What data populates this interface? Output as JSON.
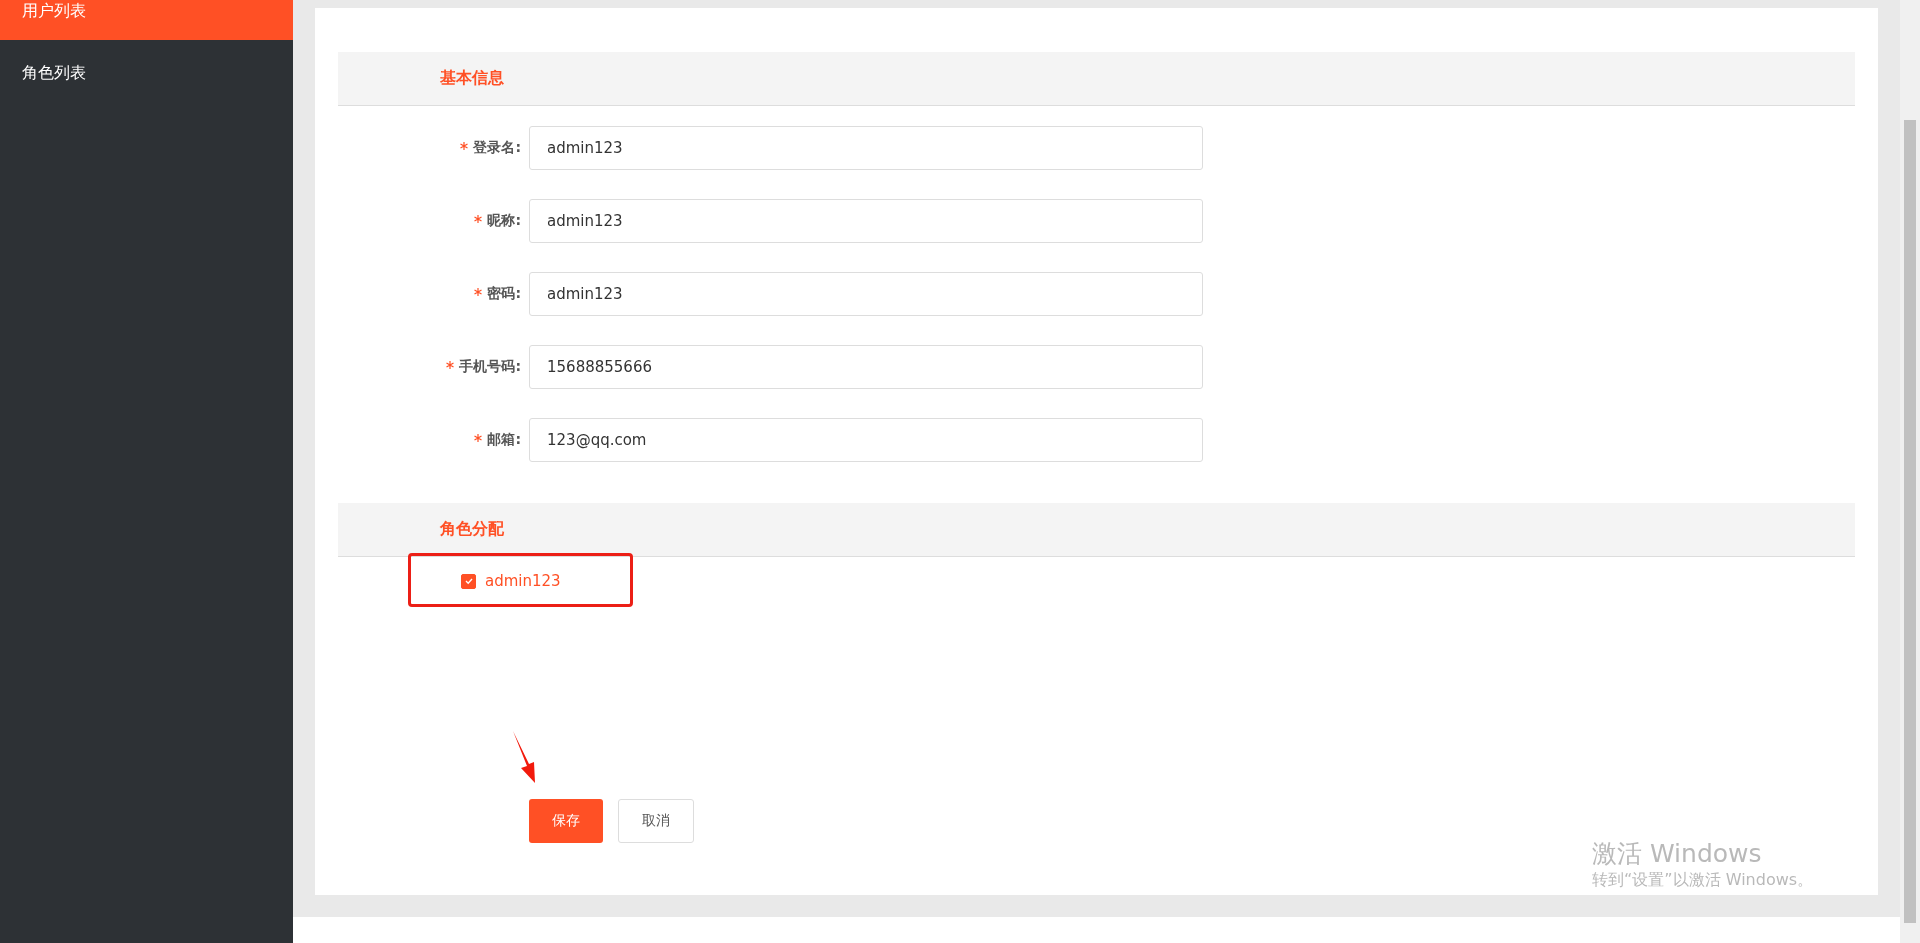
{
  "sidebar": {
    "items": [
      {
        "label": "用户列表",
        "selected": true
      },
      {
        "label": "角色列表",
        "selected": false
      }
    ]
  },
  "sections": [
    {
      "title": "基本信息",
      "kind": "fields",
      "fields": [
        {
          "label": "登录名:",
          "required": true,
          "value": "admin123"
        },
        {
          "label": "昵称:",
          "required": true,
          "value": "admin123"
        },
        {
          "label": "密码:",
          "required": true,
          "value": "admin123"
        },
        {
          "label": "手机号码:",
          "required": true,
          "value": "15688855666"
        },
        {
          "label": "邮箱:",
          "required": true,
          "value": "123@qq.com"
        }
      ]
    },
    {
      "title": "角色分配",
      "kind": "checkboxes",
      "options": [
        {
          "label": "admin123",
          "checked": true
        }
      ]
    }
  ],
  "buttons": [
    {
      "label": "保存",
      "kind": "primary"
    },
    {
      "label": "取消",
      "kind": "default"
    }
  ],
  "activation_notice": {
    "title": "激活 Windows",
    "subtitle": "转到“设置”以激活 Windows。"
  }
}
